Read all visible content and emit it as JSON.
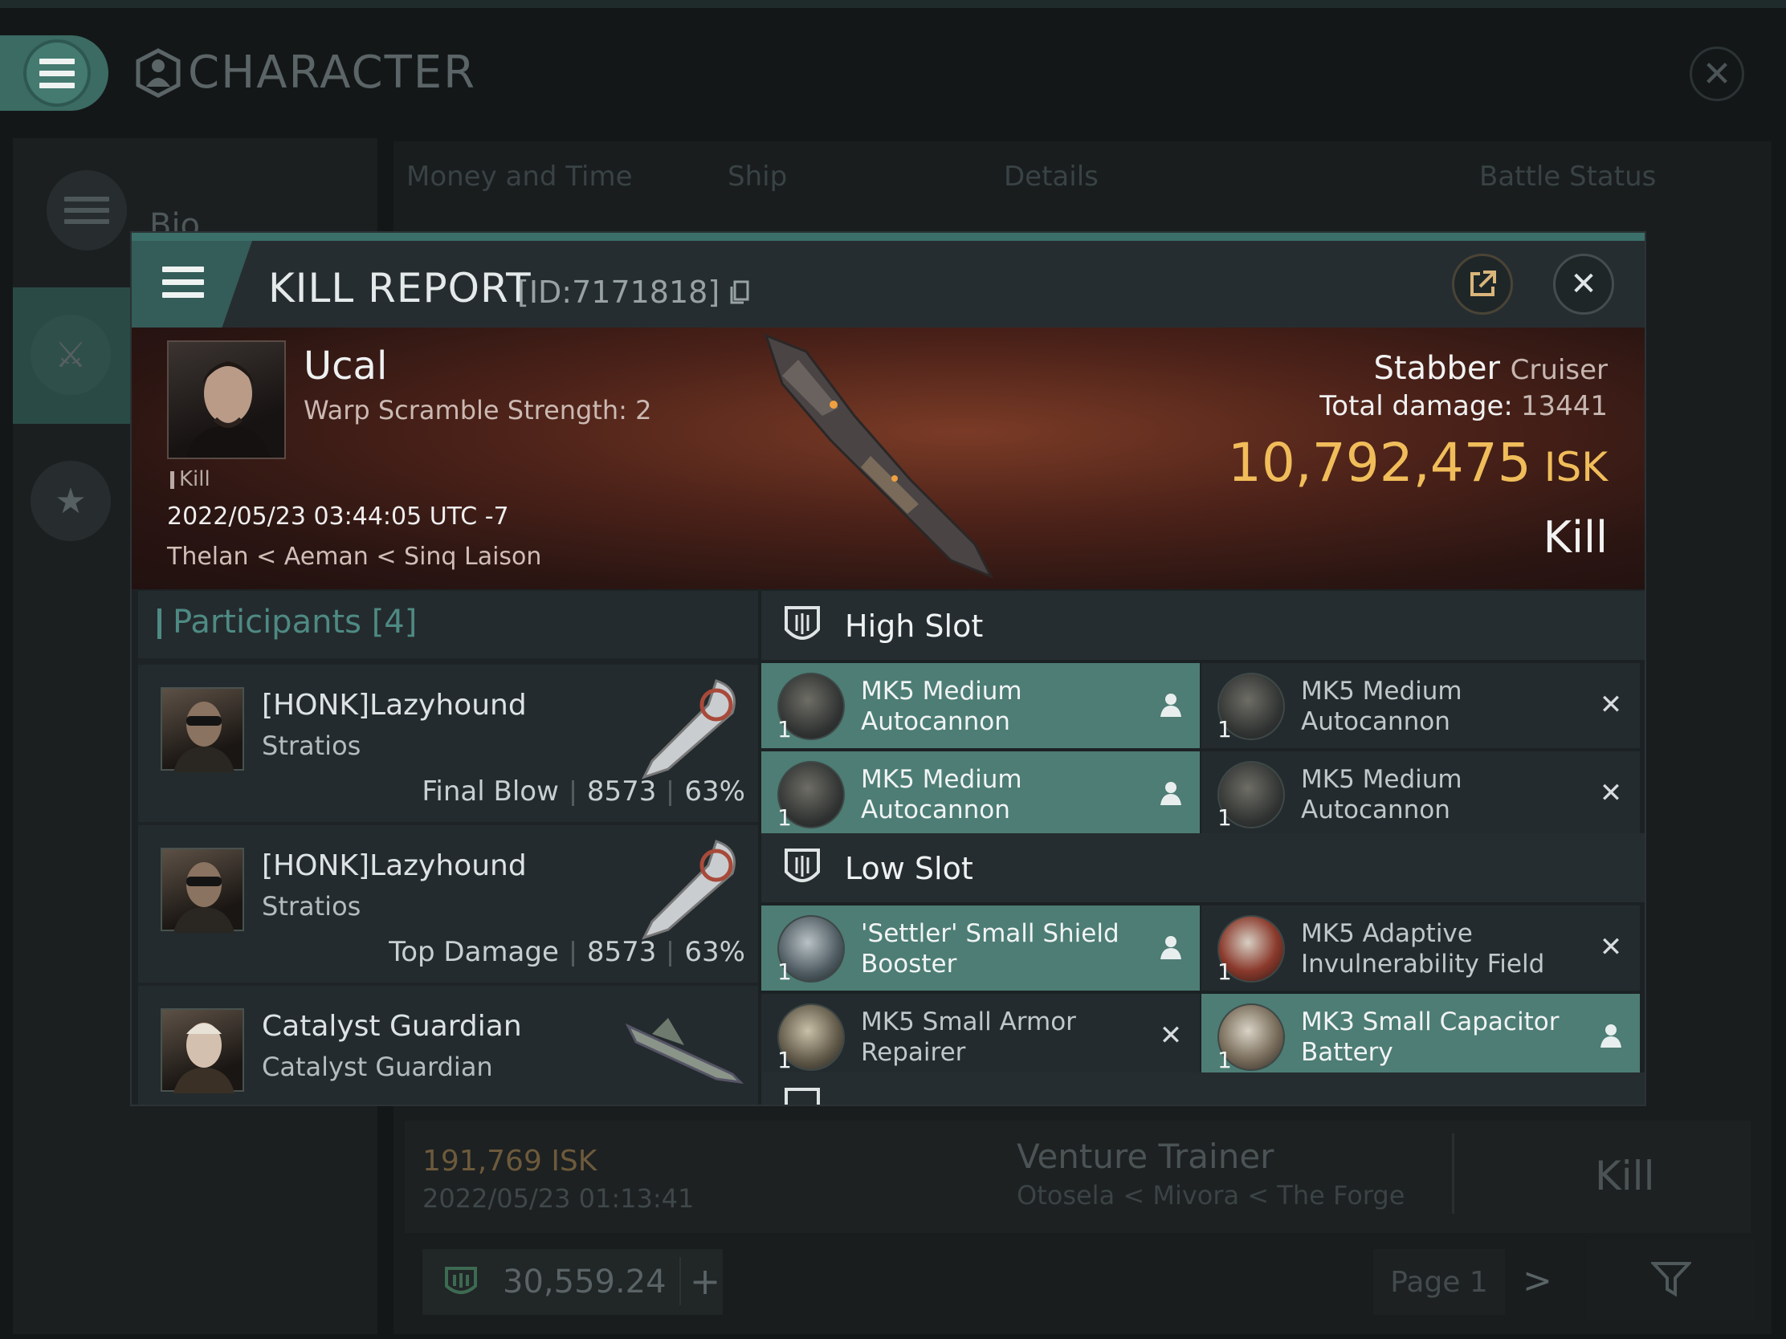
{
  "app": {
    "title": "CHARACTER",
    "sidebar": {
      "bio_label": "Bio"
    },
    "tabs": [
      "Money and Time",
      "Ship",
      "Details",
      "Battle Status"
    ],
    "background_row": {
      "isk": "191,769  ISK",
      "date": "2022/05/23  01:13:41",
      "ship": "Venture Trainer",
      "location": "Otosela < Mivora < The Forge",
      "result": "Kill"
    },
    "wallet": {
      "amount": "30,559.24",
      "plus": "+"
    },
    "pagination": {
      "page": "Page 1",
      "next": ">"
    }
  },
  "kill_report": {
    "title": "KILL REPORT",
    "id": "[ID:7171818]",
    "victim": {
      "name": "Ucal",
      "subtitle": "Warp Scramble Strength: 2",
      "tag": "Kill",
      "datetime": "2022/05/23 03:44:05 UTC -7",
      "location": "Thelan < Aeman < Sinq Laison"
    },
    "ship": {
      "name": "Stabber",
      "class": "Cruiser"
    },
    "total_damage_label": "Total damage:",
    "total_damage": "13441",
    "isk_value": "10,792,475",
    "isk_unit": "ISK",
    "result": "Kill",
    "participants": {
      "label": "Participants",
      "count": "[4]",
      "rows": [
        {
          "name": "[HONK]Lazyhound",
          "ship": "Stratios",
          "role": "Final Blow",
          "damage": "8573",
          "percent": "63%"
        },
        {
          "name": "[HONK]Lazyhound",
          "ship": "Stratios",
          "role": "Top Damage",
          "damage": "8573",
          "percent": "63%"
        },
        {
          "name": "Catalyst Guardian",
          "ship": "Catalyst Guardian"
        }
      ]
    },
    "high_slot": {
      "title": "High Slot",
      "modules": [
        {
          "qty": "1",
          "name": "MK5 Medium Autocannon",
          "state": "dropped"
        },
        {
          "qty": "1",
          "name": "MK5 Medium Autocannon",
          "state": "destroyed"
        },
        {
          "qty": "1",
          "name": "MK5 Medium Autocannon",
          "state": "dropped"
        },
        {
          "qty": "1",
          "name": "MK5 Medium Autocannon",
          "state": "destroyed"
        }
      ]
    },
    "low_slot": {
      "title": "Low Slot",
      "modules": [
        {
          "qty": "1",
          "name": "'Settler' Small Shield Booster",
          "state": "dropped"
        },
        {
          "qty": "1",
          "name": "MK5 Adaptive Invulnerability Field",
          "state": "destroyed"
        },
        {
          "qty": "1",
          "name": "MK5 Small Armor Repairer",
          "state": "destroyed"
        },
        {
          "qty": "1",
          "name": "MK3 Small Capacitor Battery",
          "state": "dropped"
        }
      ]
    }
  },
  "colors": {
    "accent": "#4d7d75",
    "isk": "#f0bd5a",
    "teal_text": "#4e8a83"
  },
  "icons": [
    "menu-icon",
    "character-icon",
    "close-icon",
    "export-icon",
    "copy-icon",
    "pilot-icon",
    "destroyed-icon",
    "slot-icon",
    "filter-icon",
    "star-icon",
    "crossed-swords-icon",
    "wallet-icon"
  ]
}
